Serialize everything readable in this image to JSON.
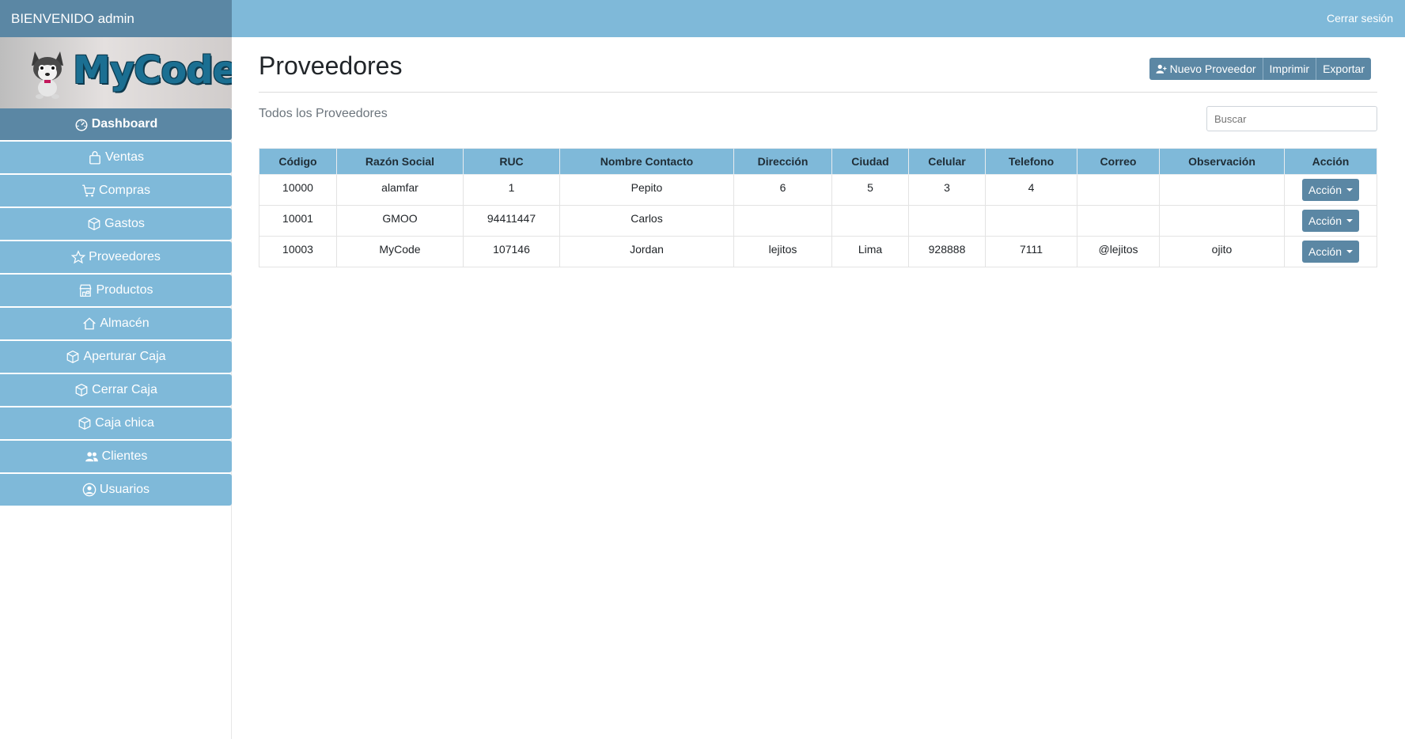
{
  "header": {
    "welcome": "BIENVENIDO admin",
    "logout": "Cerrar sesión"
  },
  "logo": {
    "text": "MyCode"
  },
  "sidebar": {
    "items": [
      {
        "label": "Dashboard",
        "icon": "dashboard-icon"
      },
      {
        "label": "Ventas",
        "icon": "bag-icon"
      },
      {
        "label": "Compras",
        "icon": "cart-icon"
      },
      {
        "label": "Gastos",
        "icon": "box-icon"
      },
      {
        "label": "Proveedores",
        "icon": "star-icon"
      },
      {
        "label": "Productos",
        "icon": "shop-icon"
      },
      {
        "label": "Almacén",
        "icon": "house-icon"
      },
      {
        "label": "Aperturar Caja",
        "icon": "box-icon"
      },
      {
        "label": "Cerrar Caja",
        "icon": "box-icon"
      },
      {
        "label": "Caja chica",
        "icon": "box-icon"
      },
      {
        "label": "Clientes",
        "icon": "people-icon"
      },
      {
        "label": "Usuarios",
        "icon": "user-circle-icon"
      }
    ]
  },
  "main": {
    "title": "Proveedores",
    "subtitle": "Todos los Proveedores",
    "buttons": {
      "new": "Nuevo Proveedor",
      "print": "Imprimir",
      "export": "Exportar"
    },
    "search_placeholder": "Buscar",
    "table": {
      "headers": [
        "Código",
        "Razón Social",
        "RUC",
        "Nombre Contacto",
        "Dirección",
        "Ciudad",
        "Celular",
        "Telefono",
        "Correo",
        "Observación",
        "Acción"
      ],
      "rows": [
        [
          "10000",
          "alamfar",
          "1",
          "Pepito",
          "6",
          "5",
          "3",
          "4",
          "",
          ""
        ],
        [
          "10001",
          "GMOO",
          "94411447",
          "Carlos",
          "",
          "",
          "",
          "",
          "",
          ""
        ],
        [
          "10003",
          "MyCode",
          "107146",
          "Jordan",
          "lejitos",
          "Lima",
          "928888",
          "7111",
          "@lejitos",
          "ojito"
        ]
      ],
      "action_label": "Acción"
    }
  },
  "colors": {
    "accent": "#7fb9d9",
    "accent_dark": "#5b87a4"
  }
}
